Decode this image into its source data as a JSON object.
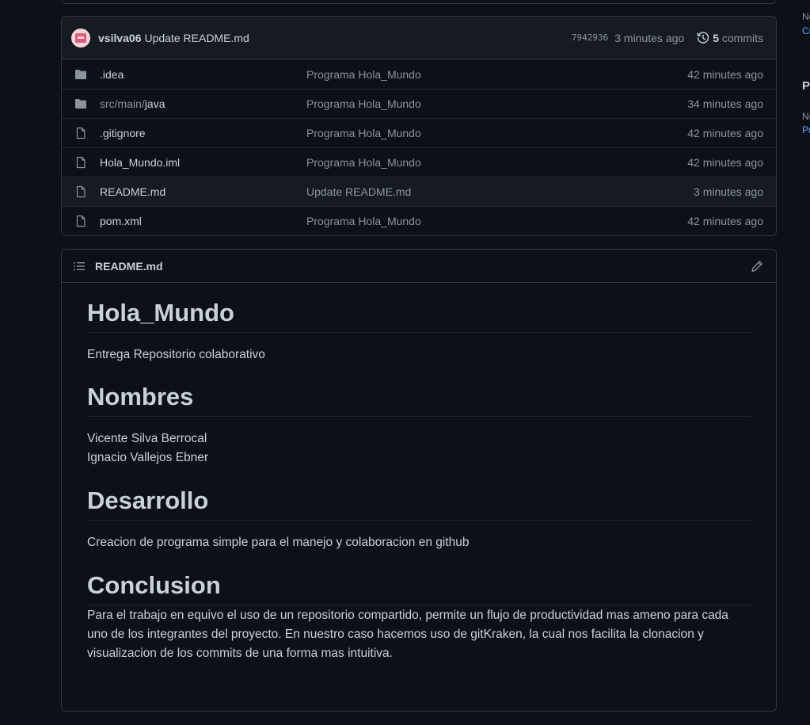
{
  "latest_commit": {
    "author": "vsilva06",
    "message": "Update README.md",
    "sha": "7942936",
    "time": "3 minutes ago",
    "commit_count": "5",
    "commits_label": "commits"
  },
  "files": [
    {
      "name": ".idea",
      "type": "folder",
      "message": "Programa Hola_Mundo",
      "time": "42 minutes ago"
    },
    {
      "name_dim": "src/main/",
      "name": "java",
      "type": "folder",
      "message": "Programa Hola_Mundo",
      "time": "34 minutes ago"
    },
    {
      "name": ".gitignore",
      "type": "file",
      "message": "Programa Hola_Mundo",
      "time": "42 minutes ago"
    },
    {
      "name": "Hola_Mundo.iml",
      "type": "file",
      "message": "Programa Hola_Mundo",
      "time": "42 minutes ago"
    },
    {
      "name": "README.md",
      "type": "file",
      "message": "Update README.md",
      "time": "3 minutes ago"
    },
    {
      "name": "pom.xml",
      "type": "file",
      "message": "Programa Hola_Mundo",
      "time": "42 minutes ago"
    }
  ],
  "readme": {
    "filename": "README.md",
    "h1_title": "Hola_Mundo",
    "intro": "Entrega Repositorio colaborativo",
    "h1_nombres": "Nombres",
    "name1": "Vicente Silva Berrocal",
    "name2": "Ignacio Vallejos Ebner",
    "h1_desarrollo": "Desarrollo",
    "desarrollo_text": "Creacion de programa simple para el manejo y colaboracion en github",
    "h1_conclusion": "Conclusion",
    "conclusion_text": "Para el trabajo en equivo el uso de un repositorio compartido, permite un flujo de productividad mas ameno para cada uno de los integrantes del proyecto. En nuestro caso hacemos uso de gitKraken, la cual nos facilita la clonacion y visualizacion de los commits de una forma mas intuitiva."
  },
  "right_rail": {
    "line1": "No",
    "line2": "Cr",
    "line3": "Pa",
    "line4": "No",
    "line5": "Pu"
  },
  "colors": {
    "background": "#0d1117",
    "border": "#30363d",
    "text": "#c9d1d9",
    "muted": "#8b949e",
    "link": "#58a6ff",
    "folder_icon": "#8b949e"
  }
}
